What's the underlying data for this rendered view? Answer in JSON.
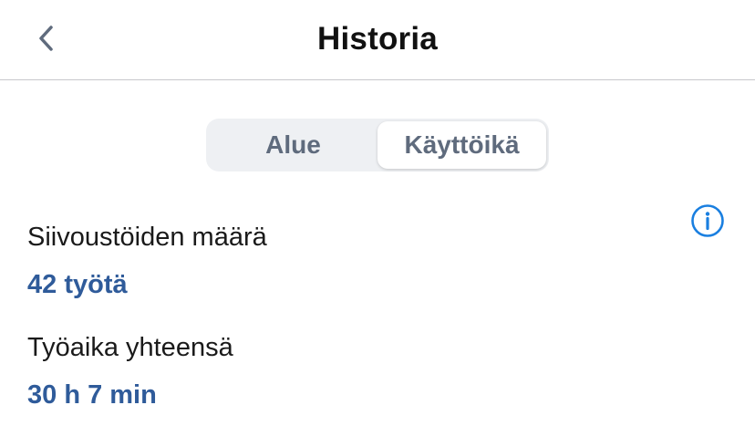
{
  "header": {
    "title": "Historia",
    "back_icon": "chevron-left-icon"
  },
  "segmented_control": {
    "options": [
      {
        "label": "Alue",
        "selected": false
      },
      {
        "label": "Käyttöikä",
        "selected": true
      }
    ]
  },
  "info_icon": "info-circle-icon",
  "stats": [
    {
      "label": "Siivoustöiden määrä",
      "value": "42 työtä"
    },
    {
      "label": "Työaika yhteensä",
      "value": "30 h 7 min"
    }
  ],
  "colors": {
    "accent": "#2f5b9a",
    "icon_blue": "#1a7fe0",
    "segment_bg": "#eef0f3",
    "divider": "#c8c8cc"
  }
}
